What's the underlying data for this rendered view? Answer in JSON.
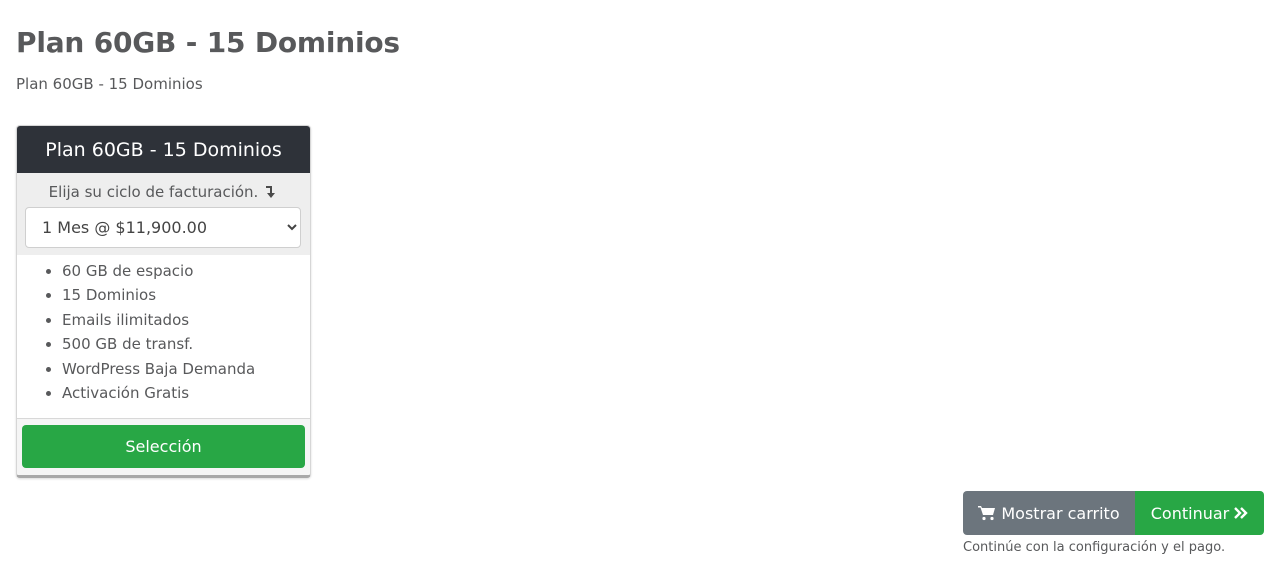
{
  "page": {
    "title": "Plan 60GB - 15 Dominios",
    "subtitle": "Plan 60GB - 15 Dominios"
  },
  "product_card": {
    "header": "Plan 60GB - 15 Dominios",
    "billing_label": "Elija su ciclo de facturación.",
    "billing_icon": "arrow-down-right-icon",
    "billing_selected": "1 Mes @ $11,900.00",
    "features": [
      "60 GB de espacio",
      "15 Dominios",
      "Emails ilimitados",
      "500 GB de transf.",
      "WordPress Baja Demanda",
      "Activación Gratis"
    ],
    "select_label": "Selección"
  },
  "actions": {
    "cart_label": "Mostrar carrito",
    "cart_icon": "shopping-cart-icon",
    "continue_label": "Continuar",
    "continue_icon": "double-chevron-right-icon",
    "help_text": "Continúe con la configuración y el pago."
  },
  "colors": {
    "header_bg": "#2e3239",
    "success": "#28a745",
    "secondary": "#6c757d",
    "text": "#58595b"
  }
}
